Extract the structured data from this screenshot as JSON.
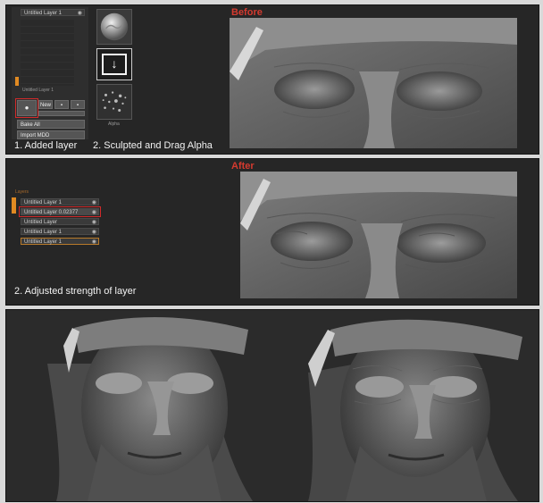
{
  "panel1": {
    "label_before": "Before",
    "caption_1": "1. Added layer",
    "caption_2": "2. Sculpted and Drag Alpha",
    "palette_header": "Untitled Layer 1",
    "layer_under": "Untitled Layer 1",
    "new_btn": "New",
    "bake_all": "Bake All",
    "import_btn": "Import MDD",
    "alpha_caption": "Alpha"
  },
  "panel2": {
    "label_after": "After",
    "caption": "2. Adjusted strength of layer",
    "palette_title": "Layers",
    "layers": [
      "Untitled Layer 1",
      "Untitled Layer 0.02377",
      "Untitled Layer",
      "Untitled Layer 1",
      "Untitled Layer 1"
    ]
  },
  "colors": {
    "accent_red": "#d43a2f",
    "highlight_orange": "#e18a22",
    "panel_bg": "#262626"
  },
  "icons": {
    "visibility": "eye-icon",
    "drag": "arrow-down-icon"
  }
}
